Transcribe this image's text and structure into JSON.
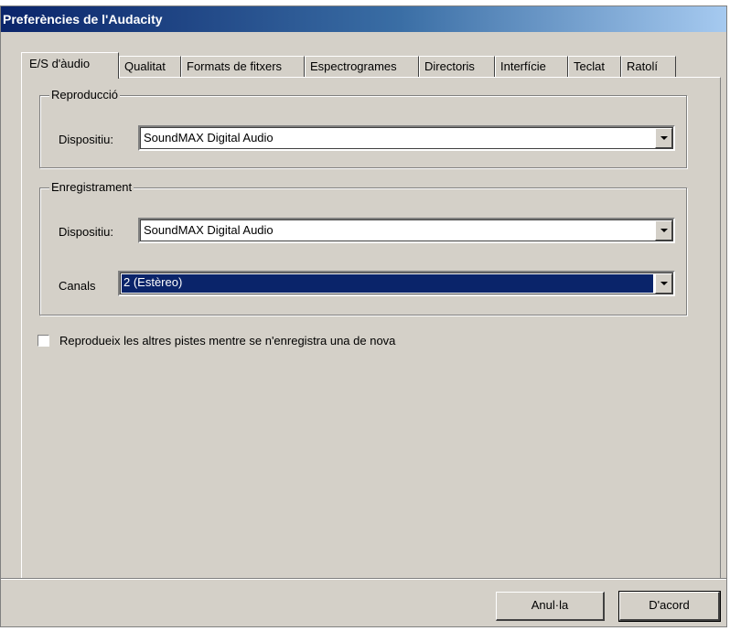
{
  "window": {
    "title": "Preferències de l'Audacity"
  },
  "tabs": [
    {
      "label": "E/S d'àudio",
      "active": true
    },
    {
      "label": "Qualitat"
    },
    {
      "label": "Formats de fitxers"
    },
    {
      "label": "Espectrogrames"
    },
    {
      "label": "Directoris"
    },
    {
      "label": "Interfície"
    },
    {
      "label": "Teclat"
    },
    {
      "label": "Ratolí"
    }
  ],
  "playback": {
    "group_label": "Reproducció",
    "device_label": "Dispositiu:",
    "device_value": "SoundMAX Digital Audio"
  },
  "recording": {
    "group_label": "Enregistrament",
    "device_label": "Dispositiu:",
    "device_value": "SoundMAX Digital Audio",
    "channels_label": "Canals",
    "channels_value": "2 (Estèreo)"
  },
  "options": {
    "overdub_label": "Reprodueix les altres pistes mentre se n'enregistra una de nova",
    "overdub_checked": false
  },
  "buttons": {
    "cancel_label": "Anul·la",
    "ok_label": "D'acord"
  },
  "colors": {
    "dialog_bg": "#d4d0c8",
    "titlebar": "#0a246a",
    "selection": "#0a246a"
  }
}
